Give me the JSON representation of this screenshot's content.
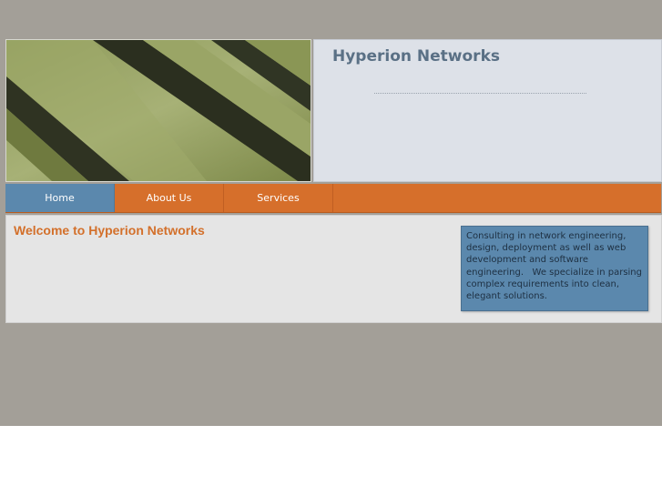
{
  "site": {
    "title": "Hyperion Networks"
  },
  "banner": {
    "image": "diagonal-wood-slats-photo"
  },
  "nav": {
    "items": [
      {
        "label": "Home",
        "active": true
      },
      {
        "label": "About Us",
        "active": false
      },
      {
        "label": "Services",
        "active": false
      }
    ]
  },
  "main": {
    "heading": "Welcome to Hyperion Networks",
    "sidebar_text": "Consulting in network engineering, design, deployment as well as web development and software engineering.   We specialize in parsing complex requirements into clean, elegant solutions."
  },
  "colors": {
    "page_background": "#a39f98",
    "nav_orange": "#d66f2b",
    "nav_active_blue": "#5b88ad",
    "heading_orange": "#d3702b",
    "title_blue_gray": "#5a7085"
  }
}
